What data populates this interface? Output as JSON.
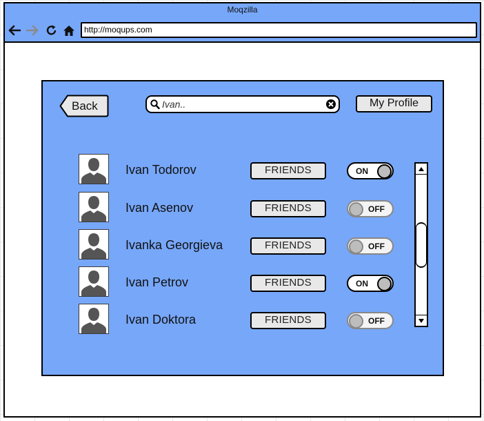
{
  "window": {
    "title": "Moqzilla",
    "url": "http://moqups.com"
  },
  "toolbar": {
    "back_icon": "arrow-left-icon",
    "forward_icon": "arrow-right-icon",
    "reload_icon": "reload-icon",
    "home_icon": "home-icon"
  },
  "header": {
    "back_label": "Back",
    "search_placeholder": "Ivan..",
    "profile_label": "My Profile"
  },
  "friends": [
    {
      "name": "Ivan Todorov",
      "status_label": "FRIENDS",
      "toggle": "ON"
    },
    {
      "name": "Ivan Asenov",
      "status_label": "FRIENDS",
      "toggle": "OFF"
    },
    {
      "name": "Ivanka Georgieva",
      "status_label": "FRIENDS",
      "toggle": "OFF"
    },
    {
      "name": "Ivan Petrov",
      "status_label": "FRIENDS",
      "toggle": "ON"
    },
    {
      "name": "Ivan Doktora",
      "status_label": "FRIENDS",
      "toggle": "OFF"
    }
  ],
  "colors": {
    "accent": "#77a7f9",
    "button_bg": "#e8e8e8",
    "avatar_fill": "#555555"
  }
}
